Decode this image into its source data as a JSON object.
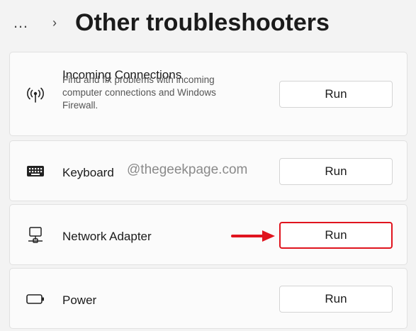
{
  "header": {
    "more_icon": "…",
    "chevron_icon": "›",
    "title": "Other troubleshooters"
  },
  "items": [
    {
      "title": "Incoming Connections",
      "description": "Find and fix problems with incoming computer connections and Windows Firewall.",
      "icon": "wireless-antenna-icon",
      "button_label": "Run"
    },
    {
      "title": "Keyboard",
      "icon": "keyboard-icon",
      "button_label": "Run"
    },
    {
      "title": "Network Adapter",
      "icon": "network-adapter-icon",
      "button_label": "Run",
      "highlighted": true
    },
    {
      "title": "Power",
      "icon": "battery-icon",
      "button_label": "Run"
    }
  ],
  "watermark": "@thegeekpage.com",
  "colors": {
    "highlight": "#e0141e",
    "background": "#f3f3f3",
    "card": "#fbfbfb"
  }
}
